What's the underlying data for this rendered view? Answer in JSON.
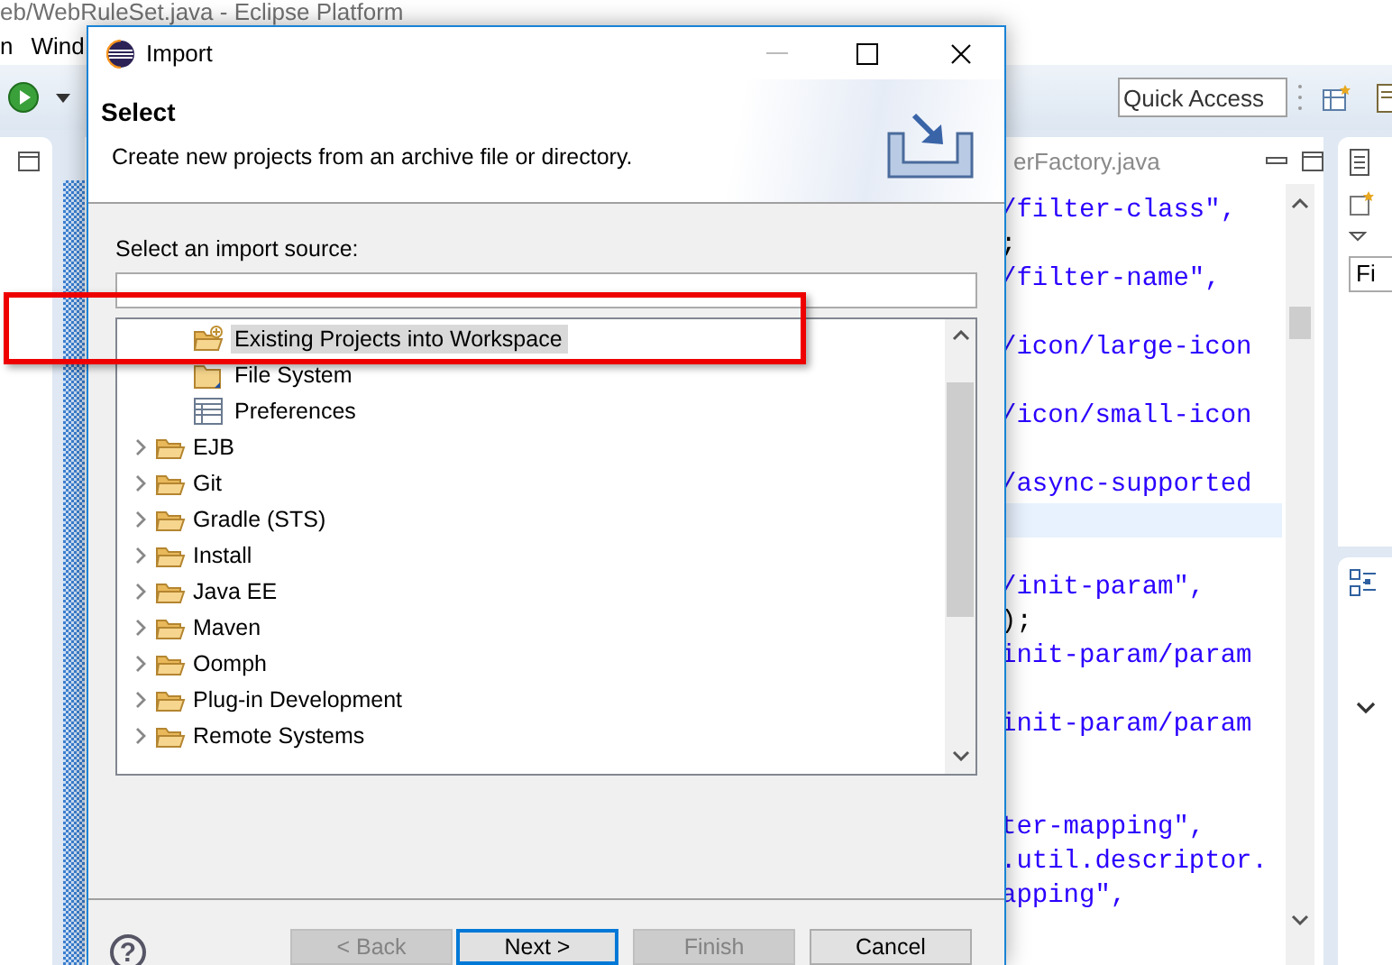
{
  "ide": {
    "title": "eb/WebRuleSet.java - Eclipse Platform",
    "menu": [
      "n",
      "Wind"
    ],
    "quick_access": {
      "placeholder": "Quick Access"
    },
    "editor_tab": "erFactory.java",
    "code_lines": [
      {
        "kind": "string",
        "text": "/filter-class\","
      },
      {
        "kind": "plain",
        "text": ";"
      },
      {
        "kind": "string",
        "text": "/filter-name\","
      },
      {
        "kind": "blank"
      },
      {
        "kind": "string",
        "text": "/icon/large-icon"
      },
      {
        "kind": "blank"
      },
      {
        "kind": "string",
        "text": "/icon/small-icon"
      },
      {
        "kind": "blank"
      },
      {
        "kind": "string",
        "text": "/async-supported"
      },
      {
        "kind": "current"
      },
      {
        "kind": "blank"
      },
      {
        "kind": "string",
        "text": "/init-param\","
      },
      {
        "kind": "plain",
        "text": ");"
      },
      {
        "kind": "string",
        "text": "init-param/param"
      },
      {
        "kind": "blank"
      },
      {
        "kind": "string",
        "text": "init-param/param"
      },
      {
        "kind": "blank"
      },
      {
        "kind": "blank"
      },
      {
        "kind": "string",
        "text": "ter-mapping\","
      },
      {
        "kind": "string",
        "text": ".util.descriptor."
      },
      {
        "kind": "string",
        "text": "apping\","
      }
    ],
    "side_field": {
      "value": "Fi"
    }
  },
  "dialog": {
    "title": "Import",
    "heading": "Select",
    "description": "Create new projects from an archive file or directory.",
    "source_label": "Select an import source:",
    "tree": {
      "nested_items": [
        {
          "label": "Existing Projects into Workspace",
          "kind": "project",
          "selected": true
        },
        {
          "label": "File System",
          "kind": "folder",
          "selected": false
        },
        {
          "label": "Preferences",
          "kind": "preferences",
          "selected": false
        }
      ],
      "items": [
        {
          "label": "EJB",
          "expanded": false,
          "selected": false
        },
        {
          "label": "Git",
          "expanded": false,
          "selected": false
        },
        {
          "label": "Gradle (STS)",
          "expanded": false,
          "selected": false
        },
        {
          "label": "Install",
          "expanded": false,
          "selected": false
        },
        {
          "label": "Java EE",
          "expanded": false,
          "selected": false
        },
        {
          "label": "Maven",
          "expanded": false,
          "selected": false
        },
        {
          "label": "Oomph",
          "expanded": false,
          "selected": false
        },
        {
          "label": "Plug-in Development",
          "expanded": false,
          "selected": false
        },
        {
          "label": "Remote Systems",
          "expanded": false,
          "selected": false
        }
      ]
    },
    "help": "?",
    "buttons": [
      {
        "label": "< Back",
        "disabled": true,
        "default": false
      },
      {
        "label": "Next >",
        "disabled": false,
        "default": true
      },
      {
        "label": "Finish",
        "disabled": true,
        "default": false
      },
      {
        "label": "Cancel",
        "disabled": false,
        "default": false
      }
    ]
  },
  "annotation": {
    "kind": "frame"
  }
}
